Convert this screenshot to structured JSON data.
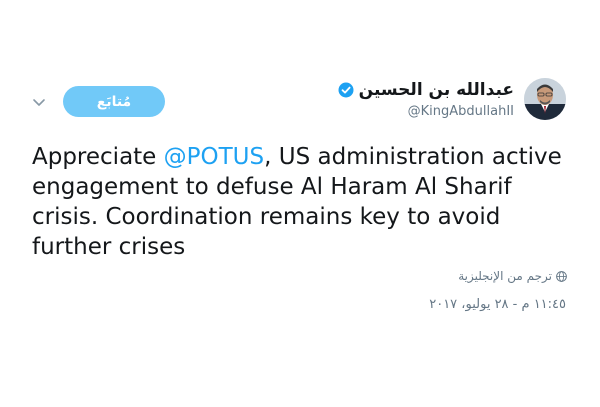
{
  "tweet": {
    "author": {
      "display_name": "عبدالله بن الحسين",
      "handle": "@KingAbdullahII",
      "verified": true,
      "avatar_icon": "profile-photo"
    },
    "follow_label": "مُتابَع",
    "menu_icon": "chevron-down-icon",
    "text": {
      "before": "Appreciate ",
      "mention": "@POTUS",
      "after": ", US administration active engagement to defuse Al Haram Al Sharif crisis. Coordination remains key to avoid further crises"
    },
    "translate_label": "ترجم من الإنجليزية",
    "timestamp": "١١:٤٥ م - ٢٨ يوليو، ٢٠١٧"
  },
  "colors": {
    "accent": "#1da1f2",
    "follow_button": "#71c9f8",
    "secondary_text": "#657786",
    "primary_text": "#14171a"
  }
}
